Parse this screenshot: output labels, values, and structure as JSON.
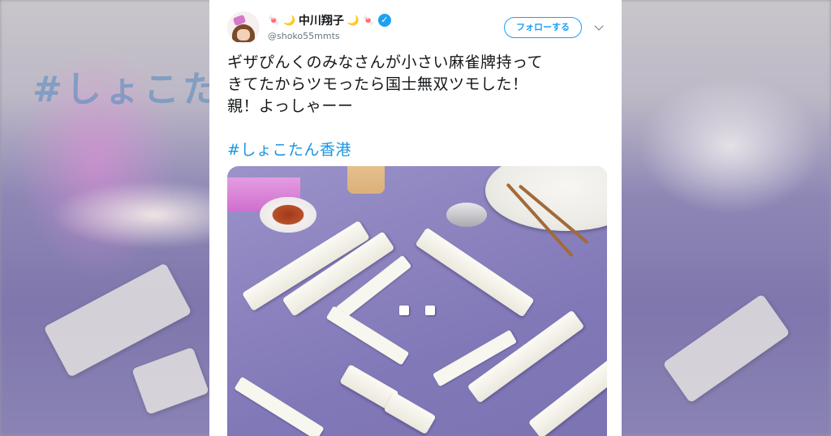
{
  "tweet": {
    "display_name": "中川翔子",
    "handle": "@shoko55mmts",
    "follow_label": "フォローする",
    "text_lines": [
      "ギザぴんくのみなさんが小さい麻雀牌持って",
      "きてたからツモったら国士無双ツモした！",
      "親！よっしゃーー"
    ],
    "hashtag": "#しょこたん香港",
    "name_decorations": [
      "🍬",
      "🌙"
    ]
  },
  "icons": {
    "verified": "verified-badge-icon",
    "menu": "chevron-down-icon"
  },
  "colors": {
    "accent": "#1da1f2",
    "hashtag": "#1b95e0",
    "text": "#14171a",
    "muted": "#657786"
  }
}
